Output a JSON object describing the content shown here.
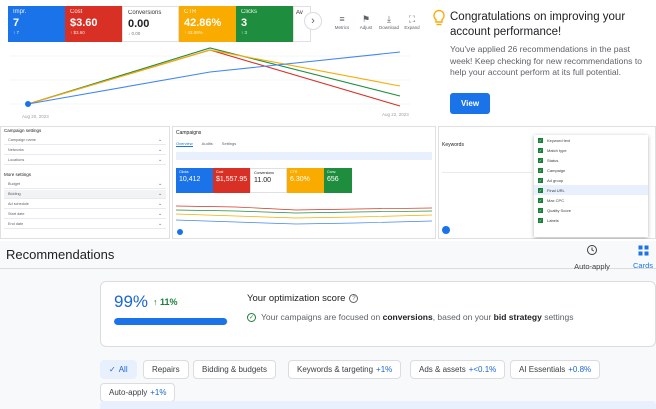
{
  "dashboard": {
    "cards": [
      {
        "label": "Impr.",
        "value": "7",
        "delta": "↑ 7",
        "color": "#1a73e8"
      },
      {
        "label": "Cost",
        "value": "$3.60",
        "delta": "↑ $3.60",
        "color": "#d93025"
      },
      {
        "label": "Conversions",
        "value": "0.00",
        "delta": "↓ 0.00",
        "color": "#ffffff"
      },
      {
        "label": "CTR",
        "value": "42.86%",
        "delta": "↑ 42.86%",
        "color": "#f9ab00"
      },
      {
        "label": "Clicks",
        "value": "3",
        "delta": "↑ 3",
        "color": "#1e8e3e"
      },
      {
        "label": "Av",
        "value": "",
        "delta": "",
        "color": "#ffffff"
      }
    ],
    "next": "›",
    "tools": [
      {
        "icon": "≡",
        "label": "Metrics"
      },
      {
        "icon": "⚑",
        "label": "Adjust"
      },
      {
        "icon": "⤓",
        "label": "Download"
      },
      {
        "icon": "⛶",
        "label": "Expand"
      }
    ],
    "date_start": "Aug 20, 2023",
    "date_end": "Aug 22, 2023"
  },
  "congrats": {
    "title": "Congratulations on improving your account performance!",
    "body": "You've applied 26 recommendations in the past week! Keep checking for new recommendations to help your account perform at its full potential.",
    "button": "View"
  },
  "settings": {
    "header": "Campaign settings",
    "rows": [
      {
        "key": "Campaign name",
        "value": ""
      },
      {
        "key": "Networks",
        "value": ""
      },
      {
        "key": "Locations",
        "value": ""
      }
    ],
    "header2": "More settings",
    "rows2": [
      {
        "key": "Budget",
        "value": ""
      },
      {
        "key": "Bidding",
        "value": ""
      },
      {
        "key": "Ad schedule",
        "value": ""
      },
      {
        "key": "Start date",
        "value": ""
      },
      {
        "key": "End date",
        "value": ""
      }
    ]
  },
  "campaigns": {
    "title": "Campaigns",
    "tabs": [
      "Overview",
      "Audits",
      "Settings"
    ],
    "cards": [
      {
        "label": "Clicks",
        "value": "10,412",
        "color": "#1a73e8"
      },
      {
        "label": "Cost",
        "value": "$1,557.95",
        "color": "#d93025"
      },
      {
        "label": "Conversions",
        "value": "11.00",
        "color": "#ffffff"
      },
      {
        "label": "CTR",
        "value": "6.30%",
        "color": "#f9ab00"
      },
      {
        "label": "Conv.",
        "value": "656",
        "color": "#1e8e3e"
      }
    ]
  },
  "keywords": {
    "title": "Keywords",
    "items": [
      {
        "label": "Keyword text",
        "selected": false
      },
      {
        "label": "Match type",
        "selected": false
      },
      {
        "label": "Status",
        "selected": false
      },
      {
        "label": "Campaign",
        "selected": false
      },
      {
        "label": "Ad group",
        "selected": false
      },
      {
        "label": "Final URL",
        "selected": true
      },
      {
        "label": "Max CPC",
        "selected": false
      },
      {
        "label": "Quality Score",
        "selected": false
      },
      {
        "label": "Labels",
        "selected": false
      }
    ]
  },
  "recommendations": {
    "title": "Recommendations",
    "auto_apply": "Auto-apply",
    "cards_label": "Cards",
    "score": "99%",
    "score_delta": "↑ 11%",
    "score_fraction": 0.99,
    "score_title": "Your optimization score",
    "status_prefix": "Your campaigns are focused on ",
    "status_bold1": "conversions",
    "status_mid": ", based on your ",
    "status_bold2": "bid strategy",
    "status_suffix": " settings",
    "chips": [
      {
        "label": "All",
        "plus": "",
        "active": true
      },
      {
        "label": "Repairs",
        "plus": "",
        "active": false
      },
      {
        "label": "Bidding & budgets",
        "plus": "",
        "active": false
      },
      {
        "label": "Keywords & targeting",
        "plus": "+1%",
        "active": false
      },
      {
        "label": "Ads & assets",
        "plus": "+<0.1%",
        "active": false
      },
      {
        "label": "AI Essentials",
        "plus": "+0.8%",
        "active": false
      },
      {
        "label": "Auto-apply",
        "plus": "+1%",
        "active": false
      }
    ]
  }
}
